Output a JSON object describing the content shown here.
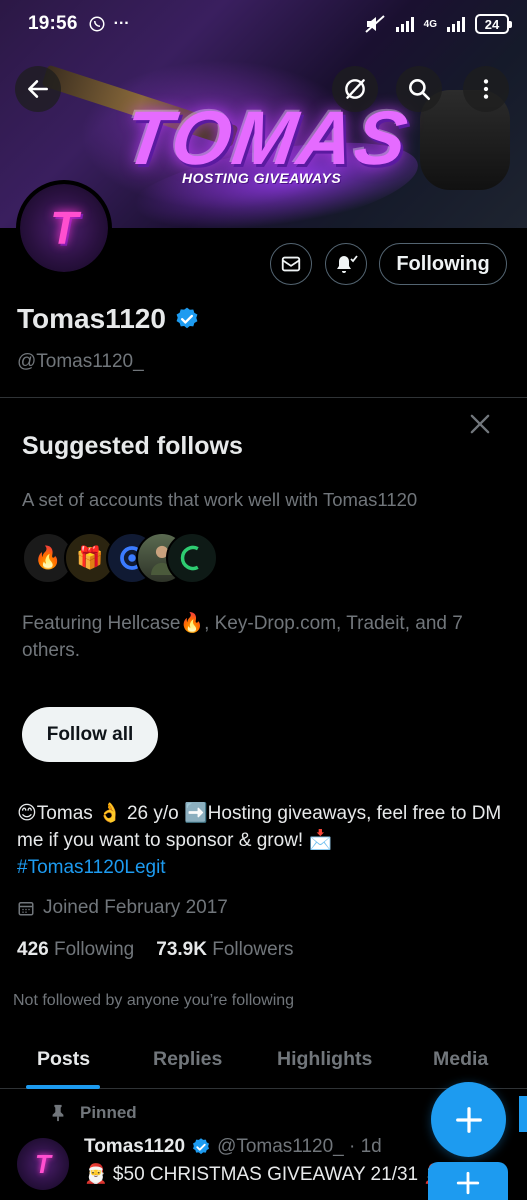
{
  "status_bar": {
    "time": "19:56",
    "network": "4G",
    "battery": "24",
    "icons": [
      "whatsapp-icon",
      "more-dots-icon",
      "mute-icon",
      "signal-icon",
      "battery-icon"
    ]
  },
  "banner": {
    "title": "TOMAS",
    "subtitle": "HOSTING GIVEAWAYS",
    "accent": "#c23cff"
  },
  "profile": {
    "name": "Tomas1120",
    "handle": "@Tomas1120_",
    "following_label": "Following",
    "avatar_letter": "T",
    "verified_color": "#1d9bf0"
  },
  "suggested": {
    "title": "Suggested follows",
    "description": "A set of accounts that work well with Tomas1120",
    "featuring": "Featuring Hellcase🔥, Key-Drop.com, Tradeit, and 7 others.",
    "follow_all_label": "Follow all"
  },
  "bio": {
    "text": "😊Tomas 👌 26 y/o ➡️Hosting giveaways, feel free to DM me if you want to sponsor & grow! 📩",
    "hashtag": "#Tomas1120Legit",
    "joined": "Joined February 2017",
    "following_count": "426",
    "following_label": "Following",
    "followers_count": "73.9K",
    "followers_label": "Followers",
    "not_followed": "Not followed by anyone you’re following"
  },
  "tabs": {
    "posts": "Posts",
    "replies": "Replies",
    "highlights": "Highlights",
    "media": "Media",
    "active": "Posts"
  },
  "pinned_post": {
    "pinned_label": "Pinned",
    "author": "Tomas1120",
    "handle_time": "@Tomas1120_ · 1d",
    "text": "🎅 $50 CHRISTMAS GIVEAWAY 21/31 🎅"
  },
  "colors": {
    "accent": "#1d9bf0",
    "muted": "#71767b",
    "border": "#2f3336"
  }
}
